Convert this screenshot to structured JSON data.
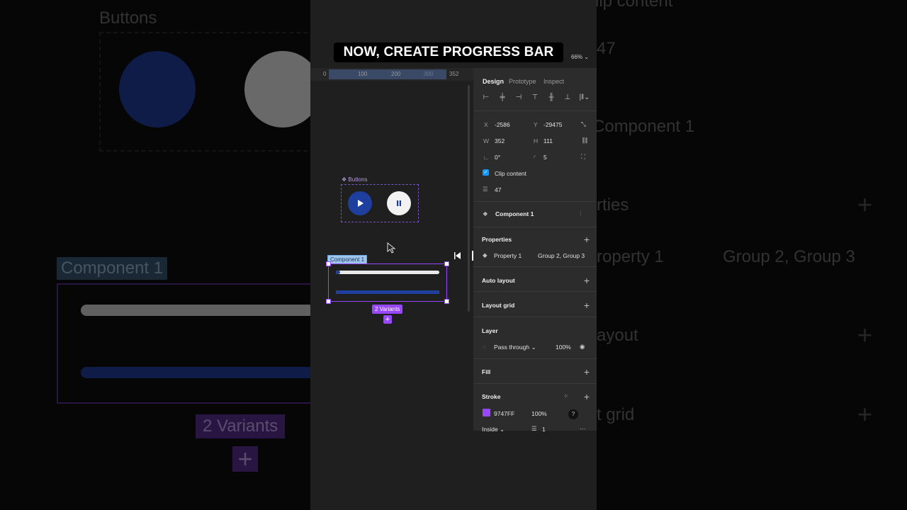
{
  "caption": "NOW, CREATE PROGRESS BAR",
  "zoom": "66%",
  "ruler": {
    "ticks": [
      "0",
      "100",
      "200",
      "300",
      "352"
    ]
  },
  "canvas": {
    "buttons_frame_label": "Buttons",
    "component_label": "Component 1",
    "variants_badge": "2 Variants",
    "variants_plus": "+",
    "progress": [
      {
        "name": "light",
        "value": 0.02
      },
      {
        "name": "filled",
        "value": 1.0
      }
    ]
  },
  "panel": {
    "tabs": [
      "Design",
      "Prototype",
      "Inspect"
    ],
    "x_label": "X",
    "x_value": "-2586",
    "y_label": "Y",
    "y_value": "-29475",
    "w_label": "W",
    "w_value": "352",
    "h_label": "H",
    "h_value": "111",
    "rotation_value": "0°",
    "radius_value": "5",
    "clip_content": "Clip content",
    "spacing_value": "47",
    "component_name": "Component 1",
    "properties_title": "Properties",
    "property_name": "Property 1",
    "property_value": "Group 2, Group 3",
    "auto_layout": "Auto layout",
    "layout_grid": "Layout grid",
    "layer_title": "Layer",
    "blend_mode": "Pass through",
    "layer_opacity": "100%",
    "fill_title": "Fill",
    "stroke_title": "Stroke",
    "stroke_color": "9747FF",
    "stroke_opacity": "100%",
    "stroke_position": "Inside",
    "stroke_weight": "1",
    "help": "?"
  },
  "background": {
    "left_title": "Buttons",
    "left_component": "Component 1",
    "left_variants": "2 Variants",
    "right_items": [
      "lip content",
      "47",
      "Component 1",
      "rties",
      "roperty 1",
      "Group 2, Group 3",
      "ayout",
      "t grid"
    ]
  },
  "colors": {
    "accent_purple": "#9747FF",
    "primary_blue": "#1f3f9e",
    "selection_blue": "#0d99ff"
  }
}
